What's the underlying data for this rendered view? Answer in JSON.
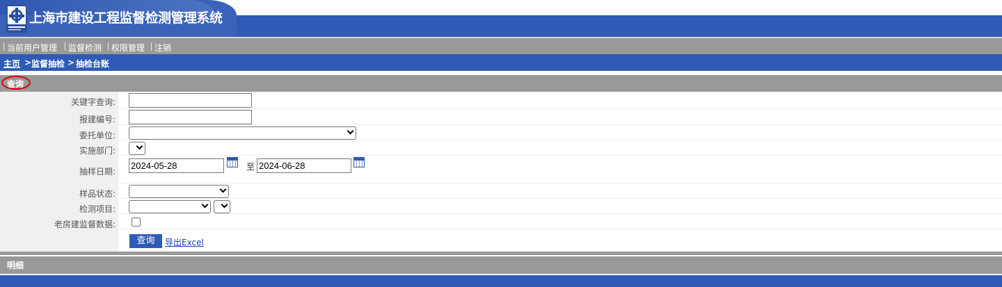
{
  "app": {
    "title": "上海市建设工程监督检测管理系统"
  },
  "nav": {
    "items": [
      "当前用户管理",
      "监督检测",
      "权限管理",
      "注销"
    ]
  },
  "breadcrumb": {
    "home": "主页",
    "sep1": " > ",
    "level1": "监督抽检",
    "sep2": " > ",
    "current": "抽检台账"
  },
  "query_section": {
    "label": "查询"
  },
  "form": {
    "keyword_label": "关键字查询:",
    "keyword_value": "",
    "report_no_label": "报建编号:",
    "report_no_value": "",
    "client_label": "委托单位:",
    "client_value": "",
    "dept_label": "实施部门:",
    "dept_value": "",
    "sample_date_label": "抽样日期:",
    "date_from": "2024-05-28",
    "date_to_label": "至",
    "date_to": "2024-06-28",
    "sample_status_label": "样品状态:",
    "sample_status_value": "",
    "test_item_label": "检测项目:",
    "test_item_value": "",
    "test_item_sub_value": "",
    "old_house_label": "老房建监督数据:",
    "old_house_checked": false,
    "search_button": "查询",
    "export_link": "导出Excel"
  },
  "detail_section": {
    "label": "明细"
  },
  "colors": {
    "brand_blue": "#2f5bb6",
    "bar_gray": "#999999",
    "highlight": "#e10000"
  }
}
